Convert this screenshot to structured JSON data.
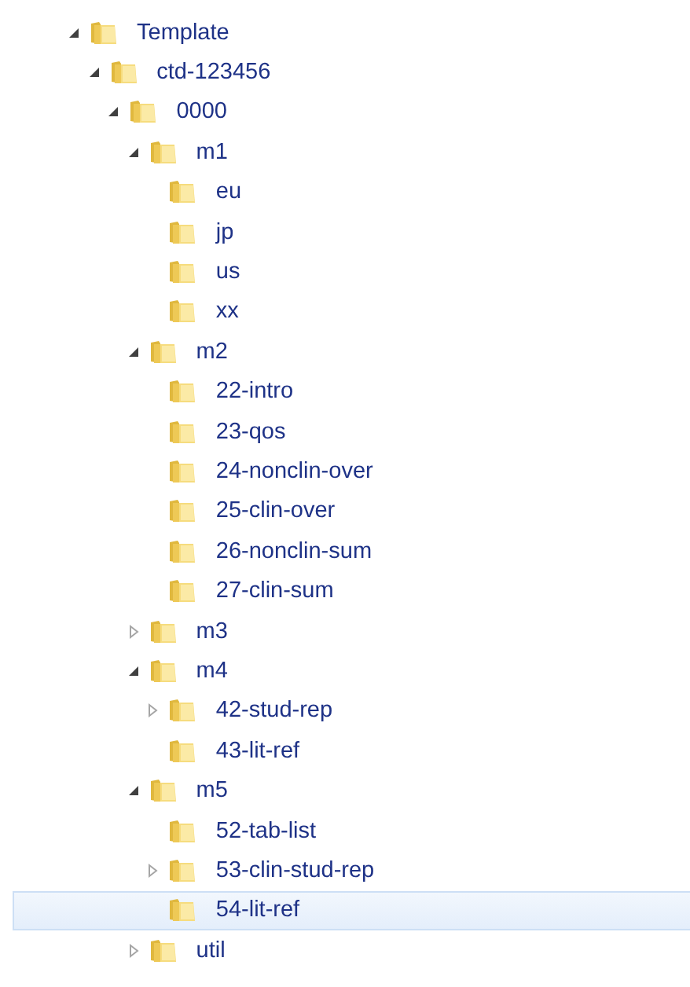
{
  "tree": [
    {
      "label": "Template",
      "expanded": true,
      "selected": false,
      "children": [
        {
          "label": "ctd-123456",
          "expanded": true,
          "selected": false,
          "children": [
            {
              "label": "0000",
              "expanded": true,
              "selected": false,
              "children": [
                {
                  "label": "m1",
                  "expanded": true,
                  "selected": false,
                  "children": [
                    {
                      "label": "eu",
                      "selected": false
                    },
                    {
                      "label": "jp",
                      "selected": false
                    },
                    {
                      "label": "us",
                      "selected": false
                    },
                    {
                      "label": "xx",
                      "selected": false
                    }
                  ]
                },
                {
                  "label": "m2",
                  "expanded": true,
                  "selected": false,
                  "children": [
                    {
                      "label": "22-intro",
                      "selected": false
                    },
                    {
                      "label": "23-qos",
                      "selected": false
                    },
                    {
                      "label": "24-nonclin-over",
                      "selected": false
                    },
                    {
                      "label": "25-clin-over",
                      "selected": false
                    },
                    {
                      "label": "26-nonclin-sum",
                      "selected": false
                    },
                    {
                      "label": "27-clin-sum",
                      "selected": false
                    }
                  ]
                },
                {
                  "label": "m3",
                  "expanded": false,
                  "selected": false
                },
                {
                  "label": "m4",
                  "expanded": true,
                  "selected": false,
                  "children": [
                    {
                      "label": "42-stud-rep",
                      "expanded": false,
                      "selected": false
                    },
                    {
                      "label": "43-lit-ref",
                      "selected": false
                    }
                  ]
                },
                {
                  "label": "m5",
                  "expanded": true,
                  "selected": false,
                  "children": [
                    {
                      "label": "52-tab-list",
                      "selected": false
                    },
                    {
                      "label": "53-clin-stud-rep",
                      "expanded": false,
                      "selected": false
                    },
                    {
                      "label": "54-lit-ref",
                      "selected": true
                    }
                  ]
                },
                {
                  "label": "util",
                  "expanded": false,
                  "selected": false
                }
              ]
            }
          ]
        }
      ]
    }
  ]
}
